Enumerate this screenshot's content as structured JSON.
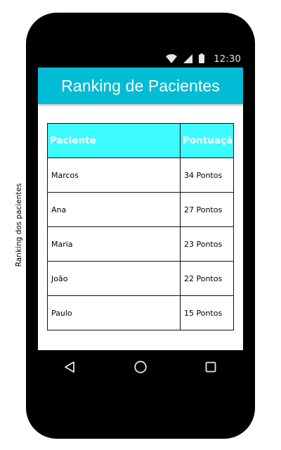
{
  "side_label": "Ranking dos pacientes",
  "status_bar": {
    "time": "12:30",
    "icons": [
      "wifi-icon",
      "signal-icon",
      "battery-icon"
    ]
  },
  "app_bar": {
    "title": "Ranking de Pacientes",
    "color": "#00bcd4"
  },
  "table": {
    "header_color": "#3cfbff",
    "columns": [
      "Paciente",
      "Pontuação"
    ],
    "rows": [
      {
        "name": "Marcos",
        "score": "34 Pontos"
      },
      {
        "name": "Ana",
        "score": "27 Pontos"
      },
      {
        "name": "Maria",
        "score": "23 Pontos"
      },
      {
        "name": "João",
        "score": "22 Pontos"
      },
      {
        "name": "Paulo",
        "score": "15 Pontos"
      }
    ]
  },
  "nav_bar": {
    "buttons": [
      "back-icon",
      "home-icon",
      "recents-icon"
    ]
  }
}
